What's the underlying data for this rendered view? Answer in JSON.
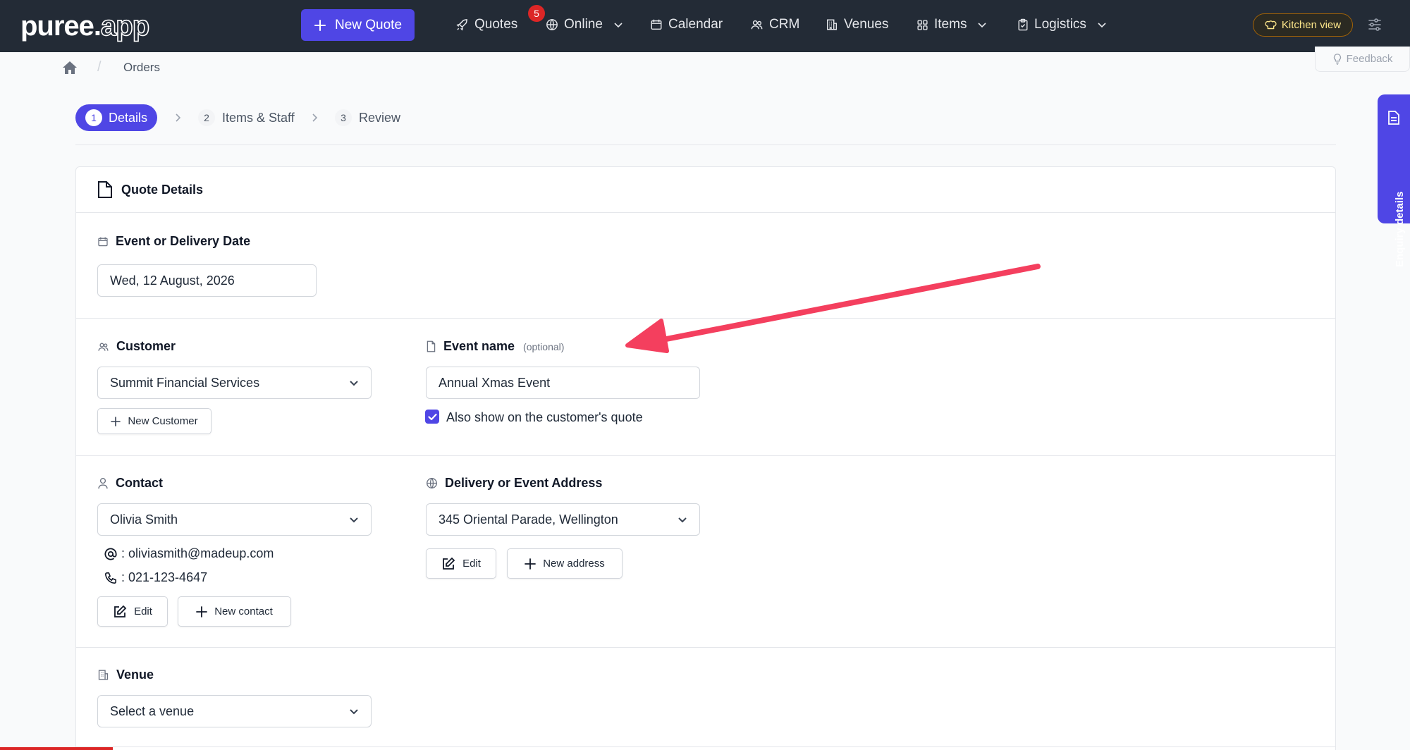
{
  "header": {
    "logo": {
      "main": "puree.",
      "suffix": "app"
    },
    "new_quote": "New Quote",
    "nav": [
      {
        "label": "Quotes",
        "icon": "rocket-icon"
      },
      {
        "label": "Online",
        "icon": "globe-icon"
      },
      {
        "label": "Calendar",
        "icon": "calendar-icon"
      },
      {
        "label": "CRM",
        "icon": "users-icon"
      },
      {
        "label": "Venues",
        "icon": "building-icon"
      },
      {
        "label": "Items",
        "icon": "grid-icon"
      },
      {
        "label": "Logistics",
        "icon": "clipboard-icon"
      }
    ],
    "online_badge": "5",
    "kitchen_view": "Kitchen view"
  },
  "breadcrumb": {
    "separator": "/",
    "current": "Orders"
  },
  "feedback": "Feedback",
  "stepper": [
    {
      "num": "1",
      "label": "Details",
      "active": true
    },
    {
      "num": "2",
      "label": "Items & Staff",
      "active": false
    },
    {
      "num": "3",
      "label": "Review",
      "active": false
    }
  ],
  "card": {
    "title": "Quote Details",
    "event_date": {
      "label": "Event or Delivery Date",
      "value": "Wed, 12 August, 2026"
    },
    "customer": {
      "label": "Customer",
      "value": "Summit Financial Services",
      "new_button": "New Customer"
    },
    "event_name": {
      "label": "Event name",
      "optional": "(optional)",
      "value": "Annual Xmas Event",
      "checkbox_label": "Also show on the customer's quote",
      "checked": true
    },
    "contact": {
      "label": "Contact",
      "value": "Olivia Smith",
      "email": ": oliviasmith@madeup.com",
      "phone": ": 021-123-4647",
      "edit": "Edit",
      "new_button": "New contact"
    },
    "address": {
      "label": "Delivery or Event Address",
      "value": "345 Oriental Parade, Wellington",
      "edit": "Edit",
      "new_button": "New address"
    },
    "venue": {
      "label": "Venue",
      "placeholder": "Select a venue"
    }
  },
  "side_tab": "Enquiry details",
  "colors": {
    "nav_bg": "#232b36",
    "accent": "#4f46e5",
    "badge": "#dc2626",
    "arrow": "#f43f5e",
    "kitchen_border": "#a16207"
  }
}
